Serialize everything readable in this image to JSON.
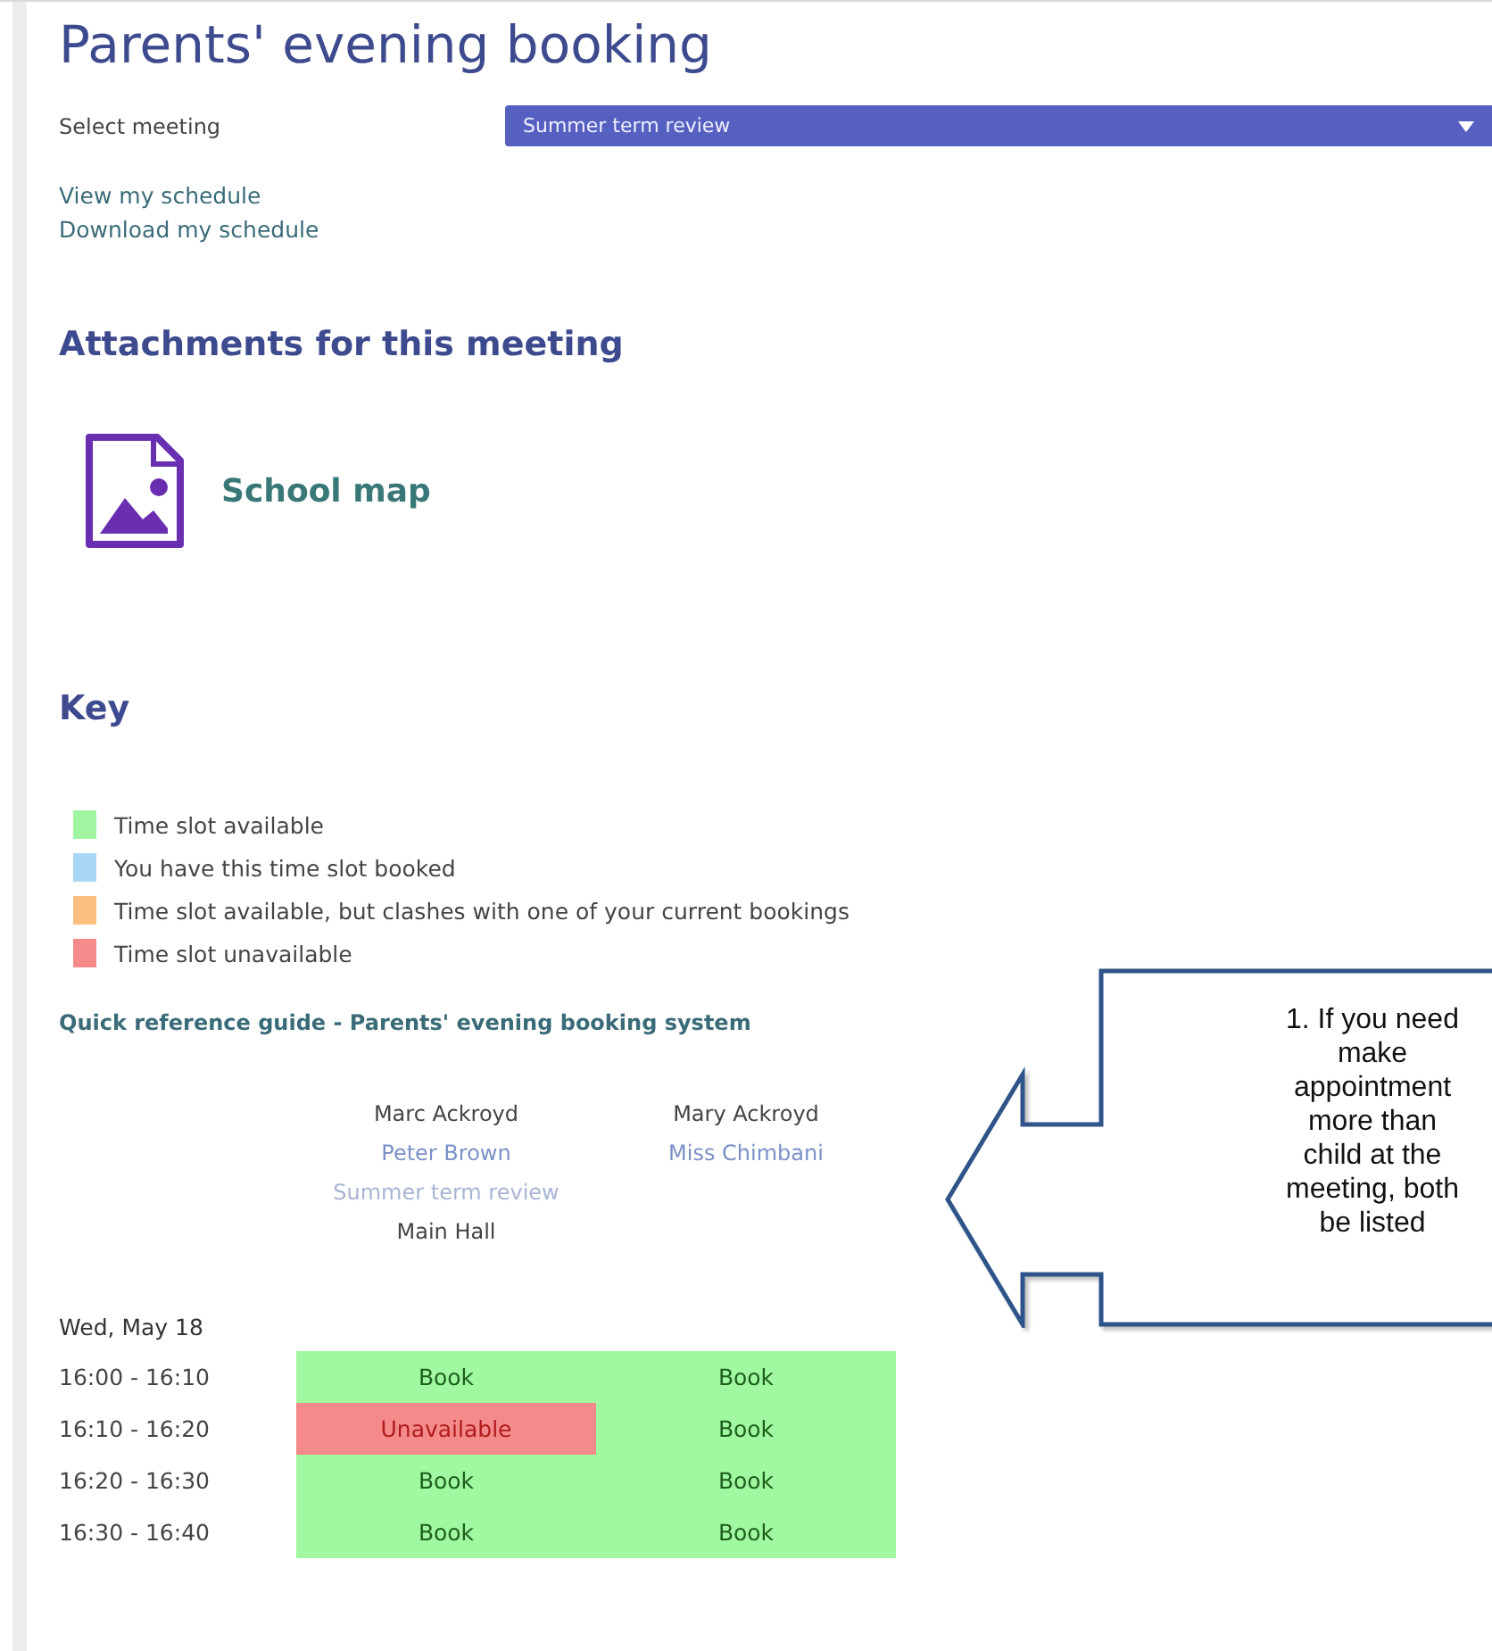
{
  "title": "Parents' evening booking",
  "meeting_select": {
    "label": "Select meeting",
    "value": "Summer term review"
  },
  "links": [
    "View my schedule",
    "Download my schedule"
  ],
  "attachments": {
    "heading": "Attachments for this meeting",
    "items": [
      {
        "label": "School map"
      }
    ]
  },
  "key": {
    "heading": "Key",
    "items": [
      {
        "label": "Time slot available",
        "color": "#a0f5a0"
      },
      {
        "label": "You have this time slot booked",
        "color": "#a8d8f5"
      },
      {
        "label": "Time slot available, but clashes with one of your current bookings",
        "color": "#fbc080"
      },
      {
        "label": "Time slot unavailable",
        "color": "#f58a8a"
      }
    ]
  },
  "guide_link": "Quick reference guide - Parents' evening booking system",
  "schedule": {
    "columns": [
      {
        "student": "Marc Ackroyd",
        "teacher": "Peter Brown",
        "meeting": "Summer term review",
        "location": "Main Hall"
      },
      {
        "student": "Mary Ackroyd",
        "teacher": "Miss Chimbani"
      }
    ],
    "date": "Wed, May 18",
    "rows": [
      {
        "time": "16:00 - 16:10",
        "slots": [
          {
            "kind": "available",
            "label": "Book"
          },
          {
            "kind": "available",
            "label": "Book"
          }
        ]
      },
      {
        "time": "16:10 - 16:20",
        "slots": [
          {
            "kind": "unavailable",
            "label": "Unavailable"
          },
          {
            "kind": "available",
            "label": "Book"
          }
        ]
      },
      {
        "time": "16:20 - 16:30",
        "slots": [
          {
            "kind": "available",
            "label": "Book"
          },
          {
            "kind": "available",
            "label": "Book"
          }
        ]
      },
      {
        "time": "16:30 - 16:40",
        "slots": [
          {
            "kind": "available",
            "label": "Book"
          },
          {
            "kind": "available",
            "label": "Book"
          }
        ]
      }
    ]
  },
  "callout": {
    "lines": [
      "1. If you need",
      "make",
      "appointment",
      "more than",
      "child at the",
      "meeting, both",
      "be listed"
    ]
  }
}
